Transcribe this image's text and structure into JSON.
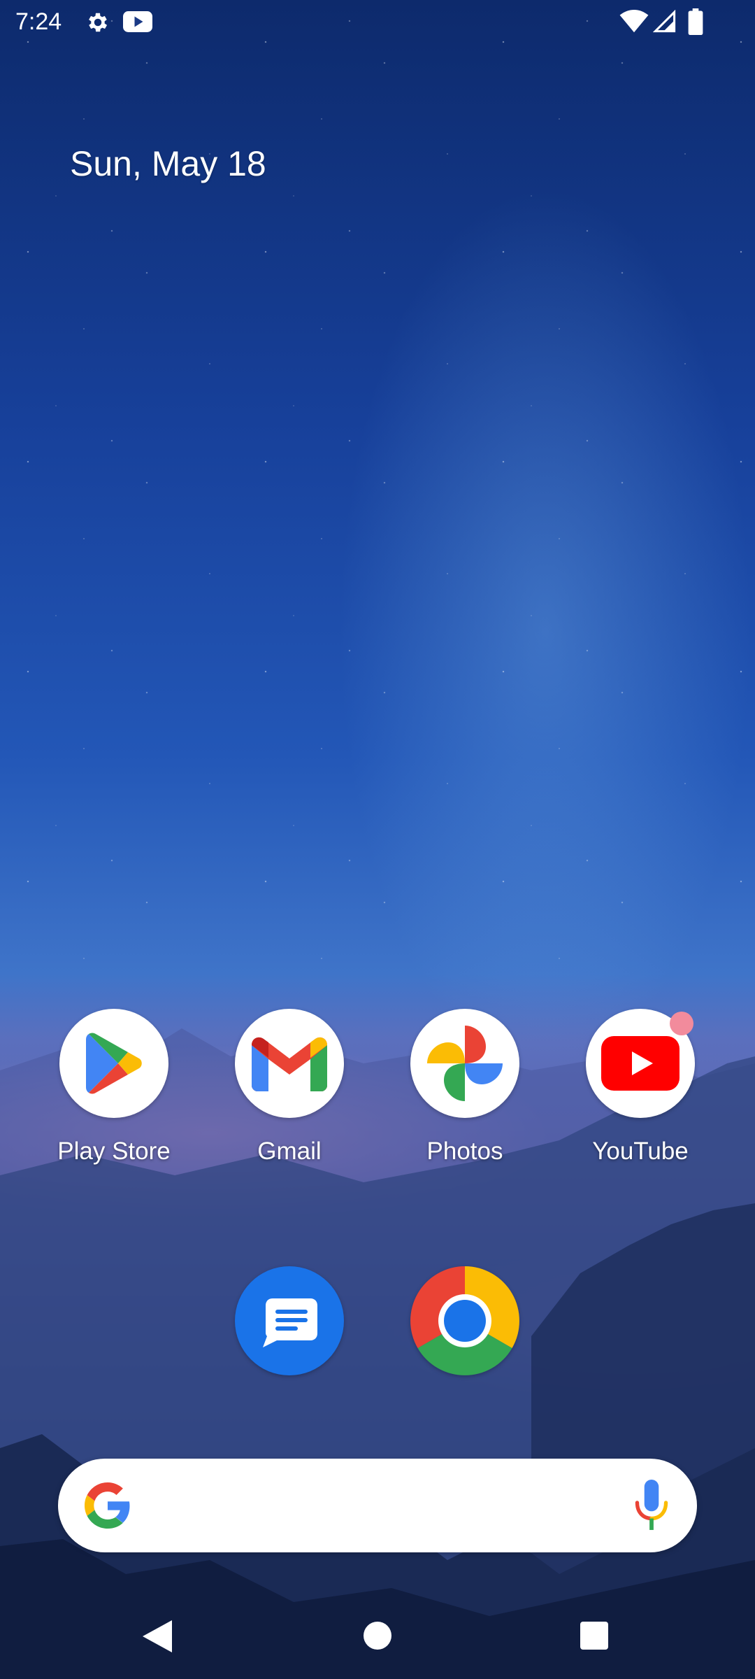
{
  "status_bar": {
    "time": "7:24",
    "icons": [
      "gear-icon",
      "youtube-notification-icon",
      "wifi-icon",
      "signal-icon",
      "battery-icon"
    ]
  },
  "date_widget": {
    "text": "Sun, May 18"
  },
  "apps": [
    {
      "label": "Play Store",
      "icon": "play-store-icon"
    },
    {
      "label": "Gmail",
      "icon": "gmail-icon"
    },
    {
      "label": "Photos",
      "icon": "photos-icon"
    },
    {
      "label": "YouTube",
      "icon": "youtube-icon",
      "has_notification_dot": true
    }
  ],
  "dock": [
    {
      "name": "Messages",
      "icon": "messages-icon"
    },
    {
      "name": "Chrome",
      "icon": "chrome-icon"
    }
  ],
  "search_bar": {
    "logo": "google-g-icon",
    "mic": "mic-icon"
  },
  "nav_bar": {
    "buttons": [
      "back",
      "home",
      "recents"
    ]
  },
  "colors": {
    "google_blue": "#4285F4",
    "google_red": "#EA4335",
    "google_yellow": "#FBBC05",
    "google_green": "#34A853",
    "youtube_red": "#FF0000",
    "messages_blue": "#1A73E8",
    "notification_dot": "#F28B9C"
  }
}
